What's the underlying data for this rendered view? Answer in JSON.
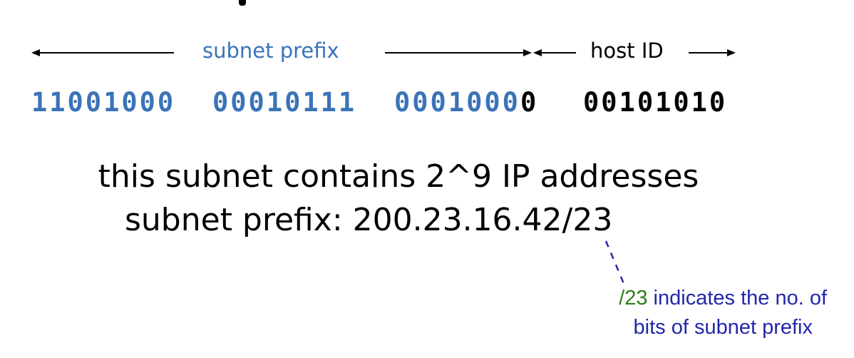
{
  "arrows": {
    "subnet_label": "subnet prefix",
    "host_label": "host ID"
  },
  "binary": {
    "octet1": "11001000",
    "octet2": "00010111",
    "octet3_prefix": "0001000",
    "octet3_host": "0",
    "octet4": "00101010"
  },
  "statement": {
    "contains": "this subnet contains 2^9 IP addresses",
    "prefix": "subnet prefix: 200.23.16.42/23"
  },
  "annotation": {
    "suffix": "/23",
    "line1_rest": " indicates the no. of",
    "line2": "bits of subnet prefix"
  },
  "colors": {
    "prefix_blue": "#3a73b8",
    "note_blue": "#2327a8",
    "note_green": "#2e7d1a",
    "text_black": "#000000"
  }
}
